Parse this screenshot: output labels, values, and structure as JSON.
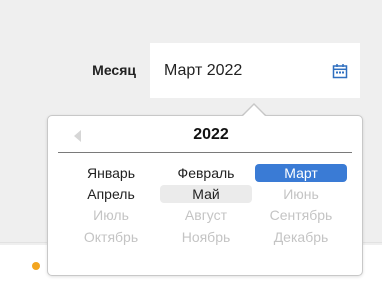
{
  "field": {
    "label": "Месяц",
    "value": "Март 2022",
    "icon": "calendar-icon"
  },
  "picker": {
    "year": "2022",
    "prev_icon": "arrow-left-icon",
    "months": [
      {
        "label": "Январь",
        "state": "active"
      },
      {
        "label": "Февраль",
        "state": "active"
      },
      {
        "label": "Март",
        "state": "selected"
      },
      {
        "label": "Апрель",
        "state": "active"
      },
      {
        "label": "Май",
        "state": "current"
      },
      {
        "label": "Июнь",
        "state": "disabled"
      },
      {
        "label": "Июль",
        "state": "disabled"
      },
      {
        "label": "Август",
        "state": "disabled"
      },
      {
        "label": "Сентябрь",
        "state": "disabled"
      },
      {
        "label": "Октябрь",
        "state": "disabled"
      },
      {
        "label": "Ноябрь",
        "state": "disabled"
      },
      {
        "label": "Декабрь",
        "state": "disabled"
      }
    ]
  },
  "colors": {
    "selected": "#3a7bd5",
    "current_bg": "#ebebeb",
    "disabled_text": "#c4c4c4",
    "indicator": "#f3a51f"
  }
}
